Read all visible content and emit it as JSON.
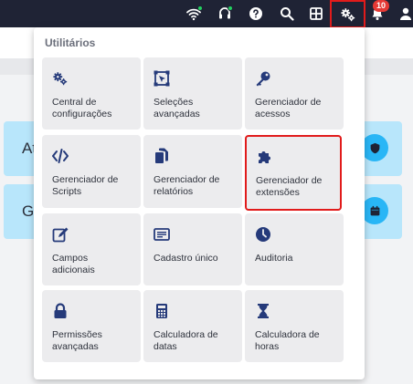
{
  "topbar": {
    "icons": [
      "wifi-icon",
      "headset-icon",
      "help-icon",
      "search-icon",
      "grid-icon",
      "gears-icon",
      "bell-icon",
      "user-icon"
    ],
    "notification_count": "10"
  },
  "background": {
    "cards": [
      {
        "label": "At",
        "icon": "shield-icon"
      },
      {
        "label": "G",
        "icon": "calendar-icon"
      }
    ]
  },
  "menu": {
    "title": "Utilitários",
    "items": [
      {
        "label": "Central de\nconfigurações",
        "icon": "gears-icon"
      },
      {
        "label": "Seleções\navançadas",
        "icon": "selection-icon"
      },
      {
        "label": "Gerenciador de\nacessos",
        "icon": "key-icon"
      },
      {
        "label": "Gerenciador de\nScripts",
        "icon": "code-icon"
      },
      {
        "label": "Gerenciador de\nrelatórios",
        "icon": "copy-icon"
      },
      {
        "label": "Gerenciador de\nextensões",
        "icon": "puzzle-icon"
      },
      {
        "label": "Campos\nadicionais",
        "icon": "edit-icon"
      },
      {
        "label": "Cadastro único",
        "icon": "id-card-icon"
      },
      {
        "label": "Auditoria",
        "icon": "clock-icon"
      },
      {
        "label": "Permissões\navançadas",
        "icon": "lock-icon"
      },
      {
        "label": "Calculadora de\ndatas",
        "icon": "calculator-icon"
      },
      {
        "label": "Calculadora de\nhoras",
        "icon": "hourglass-icon"
      }
    ],
    "highlighted_item": "Gerenciador de\nextensões"
  },
  "colors": {
    "topbar": "#1f2335",
    "icon": "#253a7a",
    "tile": "#ececee",
    "highlight": "#e11b1b",
    "card": "#b8e6fb",
    "card_circle": "#29b6f6"
  }
}
